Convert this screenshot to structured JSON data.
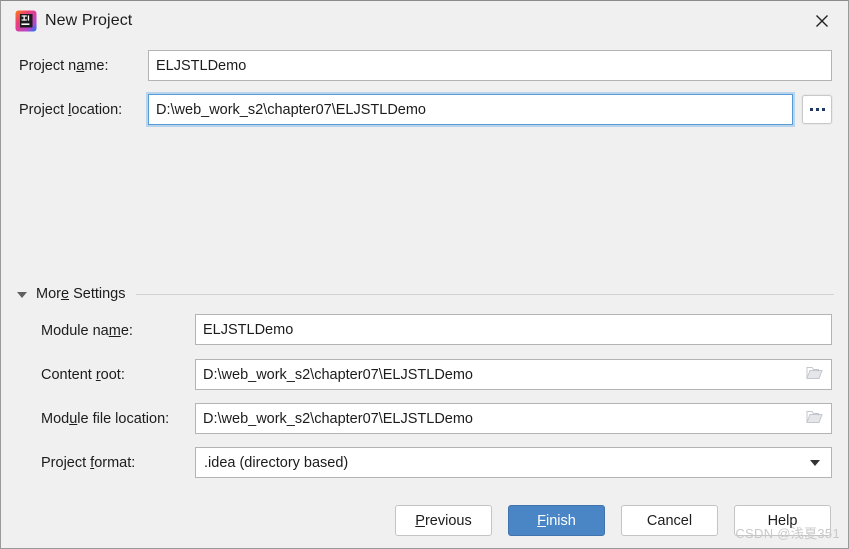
{
  "window": {
    "title": "New Project",
    "app_icon": "intellij-idea-icon",
    "close_label": "✕",
    "background": "#f0f0f0"
  },
  "top_fields": [
    {
      "label_pre": "Project n",
      "label_mnemonic": "a",
      "label_post": "me:",
      "value": "ELJSTLDemo",
      "placeholder": "",
      "focused": false
    },
    {
      "label_pre": "Project ",
      "label_mnemonic": "l",
      "label_post": "ocation:",
      "value": "D:\\web_work_s2\\chapter07\\ELJSTLDemo",
      "placeholder": "",
      "focused": true
    }
  ],
  "browse_button": {
    "name": "browse-ellipsis-button",
    "label": "..."
  },
  "more_settings": {
    "text_pre": "Mor",
    "text_mnemonic": "e",
    "text_post": " Settings",
    "expanded": true,
    "chevron": "triangle-down-icon"
  },
  "settings_fields": [
    {
      "label_pre": "Module na",
      "label_mnemonic": "m",
      "label_post": "e:",
      "value": "ELJSTLDemo",
      "has_folder_icon": false
    },
    {
      "label_pre": "Content ",
      "label_mnemonic": "r",
      "label_post": "oot:",
      "value": "D:\\web_work_s2\\chapter07\\ELJSTLDemo",
      "has_folder_icon": true
    },
    {
      "label_pre": "Mod",
      "label_mnemonic": "u",
      "label_post": "le file location:",
      "value": "D:\\web_work_s2\\chapter07\\ELJSTLDemo",
      "has_folder_icon": true
    }
  ],
  "project_format": {
    "label_pre": "Project ",
    "label_mnemonic": "f",
    "label_post": "ormat:",
    "selected": ".idea (directory based)",
    "options": [
      ".idea (directory based)"
    ]
  },
  "buttons": [
    {
      "name": "previous-button",
      "pre": "",
      "mnemonic": "P",
      "post": "revious",
      "primary": false
    },
    {
      "name": "finish-button",
      "pre": "",
      "mnemonic": "F",
      "post": "inish",
      "primary": true
    },
    {
      "name": "cancel-button",
      "pre": "Cancel",
      "mnemonic": "",
      "post": "",
      "primary": false
    },
    {
      "name": "help-button",
      "pre": "Help",
      "mnemonic": "",
      "post": "",
      "primary": false
    }
  ],
  "watermark": {
    "text": "CSDN @浅夏351"
  },
  "colors": {
    "accent": "#4a86c5",
    "focus_border": "#5b9bd5",
    "dialog_bg": "#f0f0f0",
    "field_border": "#b4b4b4"
  }
}
